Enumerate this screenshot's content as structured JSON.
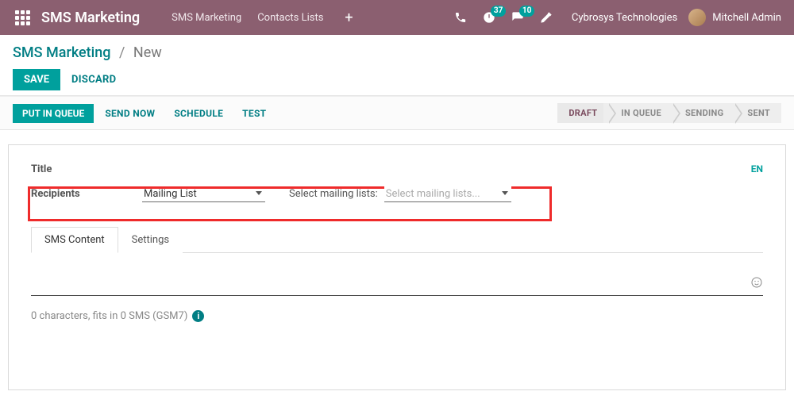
{
  "navbar": {
    "brand": "SMS Marketing",
    "links": {
      "sms_marketing": "SMS Marketing",
      "contacts_lists": "Contacts Lists"
    },
    "badges": {
      "activities": "37",
      "messages": "10"
    },
    "company": "Cybrosys Technologies",
    "user": "Mitchell Admin"
  },
  "breadcrumb": {
    "root": "SMS Marketing",
    "leaf": "New"
  },
  "actions": {
    "save": "SAVE",
    "discard": "DISCARD"
  },
  "statusbar": {
    "buttons": {
      "put_in_queue": "PUT IN QUEUE",
      "send_now": "SEND NOW",
      "schedule": "SCHEDULE",
      "test": "TEST"
    },
    "steps": {
      "draft": "DRAFT",
      "in_queue": "IN QUEUE",
      "sending": "SENDING",
      "sent": "SENT"
    }
  },
  "form": {
    "title_label": "Title",
    "title_value": "",
    "lang": "EN",
    "recipients_label": "Recipients",
    "recipients_value": "Mailing List",
    "ml_label": "Select mailing lists:",
    "ml_placeholder": "Select mailing lists...",
    "tabs": {
      "content": "SMS Content",
      "settings": "Settings"
    },
    "counter": "0 characters, fits in 0 SMS (GSM7)"
  }
}
